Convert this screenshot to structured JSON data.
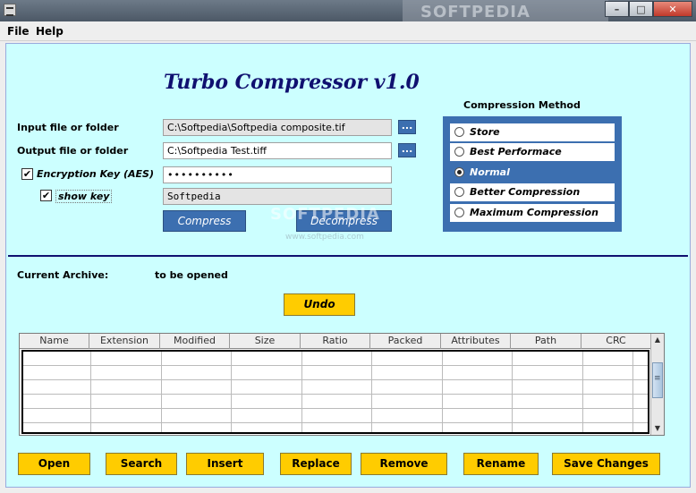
{
  "window": {
    "bg_title": "SOFTPEDIA",
    "controls": [
      "–",
      "□",
      "✕"
    ]
  },
  "menu": {
    "file": "File",
    "help": "Help"
  },
  "app": {
    "title": "Turbo Compressor v1.0",
    "input_label": "Input file or folder",
    "input_value": "C:\\Softpedia\\Softpedia composite.tif",
    "output_label": "Output file or folder",
    "output_value": "C:\\Softpedia Test.tiff",
    "browse_label": "...",
    "encryption_label": "Encryption Key (AES)",
    "encryption_checked": true,
    "encryption_value": "••••••••••",
    "showkey_label": "show key",
    "showkey_checked": true,
    "key_plain": "Softpedia",
    "compress_label": "Compress",
    "decompress_label": "Decompress",
    "watermark": "SOFTPEDIA",
    "watermark_url": "www.softpedia.com"
  },
  "compression": {
    "title": "Compression Method",
    "options": [
      "Store",
      "Best Performace",
      "Normal",
      "Better Compression",
      "Maximum Compression"
    ],
    "selected": "Normal"
  },
  "archive": {
    "label": "Current Archive:",
    "value": "to be opened",
    "undo_label": "Undo"
  },
  "table": {
    "columns": [
      "Name",
      "Extension",
      "Modified",
      "Size",
      "Ratio",
      "Packed",
      "Attributes",
      "Path",
      "CRC"
    ],
    "rows": []
  },
  "actions": [
    "Open",
    "Search",
    "Insert",
    "Replace",
    "Remove",
    "Rename",
    "Save Changes"
  ],
  "colors": {
    "panel": "#ccffff",
    "accent": "#3c6fb0",
    "action": "#ffcc00",
    "title": "#101070"
  }
}
